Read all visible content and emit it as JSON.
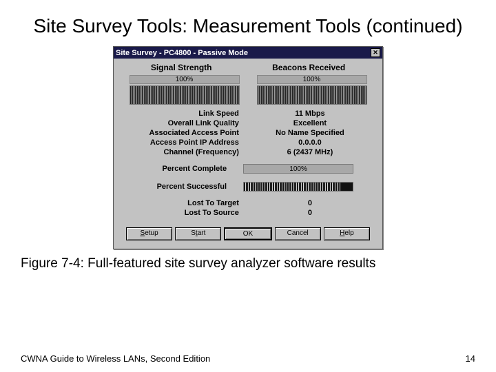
{
  "slide": {
    "title": "Site Survey Tools: Measurement Tools (continued)",
    "caption": "Figure 7-4: Full-featured site survey analyzer software results",
    "footer_left": "CWNA Guide to Wireless LANs, Second Edition",
    "footer_right": "14"
  },
  "window": {
    "title": "Site Survey - PC4800 - Passive Mode",
    "headers": {
      "left": "Signal Strength",
      "right": "Beacons Received"
    },
    "signal_pct": "100%",
    "beacons_pct": "100%",
    "rows": {
      "link_speed_label": "Link Speed",
      "link_speed_value": "11 Mbps",
      "overall_quality_label": "Overall Link Quality",
      "overall_quality_value": "Excellent",
      "assoc_ap_label": "Associated Access Point",
      "assoc_ap_value": "No Name Specified",
      "ap_ip_label": "Access Point IP Address",
      "ap_ip_value": "0.0.0.0",
      "channel_label": "Channel (Frequency)",
      "channel_value": "6   (2437 MHz)",
      "pct_complete_label": "Percent Complete",
      "pct_complete_value": "100%",
      "pct_success_label": "Percent Successful",
      "lost_target_label": "Lost To Target",
      "lost_target_value": "0",
      "lost_source_label": "Lost To Source",
      "lost_source_value": "0"
    },
    "buttons": {
      "setup": "Setup",
      "start": "Start",
      "ok": "OK",
      "cancel": "Cancel",
      "help": "Help"
    }
  }
}
